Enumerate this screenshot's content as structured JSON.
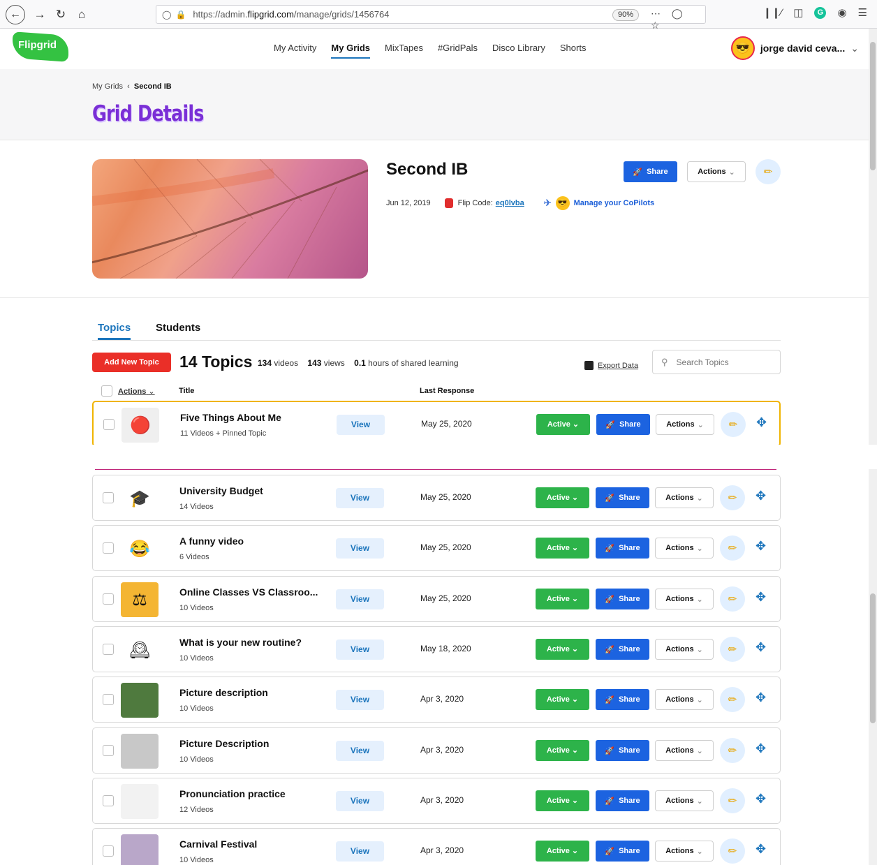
{
  "browser": {
    "url_prefix": "https://admin.",
    "url_domain": "flipgrid.com",
    "url_path": "/manage/grids/1456764",
    "zoom": "90%"
  },
  "app": {
    "logo": "Flipgrid",
    "nav": [
      "My Activity",
      "My Grids",
      "MixTapes",
      "#GridPals",
      "Disco Library",
      "Shorts"
    ],
    "user_name": "jorge david ceva..."
  },
  "header": {
    "breadcrumb_root": "My Grids",
    "breadcrumb_current": "Second IB",
    "title": "Grid Details"
  },
  "grid": {
    "name": "Second IB",
    "date": "Jun 12, 2019",
    "flip_code_label": "Flip Code:",
    "flip_code": "eq0lvba",
    "copilots": "Manage your CoPilots",
    "share_label": "Share",
    "actions_label": "Actions"
  },
  "tabs": [
    "Topics",
    "Students"
  ],
  "toolbar": {
    "add_topic": "Add New Topic",
    "topic_count": "14 Topics",
    "videos_num": "134",
    "videos_label": "videos",
    "views_num": "143",
    "views_label": "views",
    "hours_num": "0.1",
    "hours_label": "hours of shared learning",
    "export": "Export Data",
    "search_placeholder": "Search Topics"
  },
  "columns": {
    "actions": "Actions",
    "title": "Title",
    "last_response": "Last Response"
  },
  "row_buttons": {
    "view": "View",
    "active": "Active",
    "share": "Share",
    "actions": "Actions"
  },
  "topics": [
    {
      "title": "Five Things About Me",
      "sub": "11 Videos + Pinned Topic",
      "date": "May 25, 2020",
      "icon": "emoji-balls"
    },
    {
      "title": "University Budget",
      "sub": "14 Videos",
      "date": "May 25, 2020",
      "icon": "graduation-cap"
    },
    {
      "title": "A funny video",
      "sub": "6 Videos",
      "date": "May 25, 2020",
      "icon": "laughing-emoji"
    },
    {
      "title": "Online Classes VS Classroo...",
      "sub": "10 Videos",
      "date": "May 25, 2020",
      "icon": "balance-scale"
    },
    {
      "title": "What is your new routine?",
      "sub": "10 Videos",
      "date": "May 18, 2020",
      "icon": "routines-clock"
    },
    {
      "title": "Picture description",
      "sub": "10 Videos",
      "date": "Apr 3, 2020",
      "icon": "park-photo"
    },
    {
      "title": "Picture Description",
      "sub": "10 Videos",
      "date": "Apr 3, 2020",
      "icon": "people-photo"
    },
    {
      "title": "Pronunciation practice",
      "sub": "12 Videos",
      "date": "Apr 3, 2020",
      "icon": "screenshot"
    },
    {
      "title": "Carnival Festival",
      "sub": "10 Videos",
      "date": "Apr 3, 2020",
      "icon": "carnival-photo"
    }
  ]
}
